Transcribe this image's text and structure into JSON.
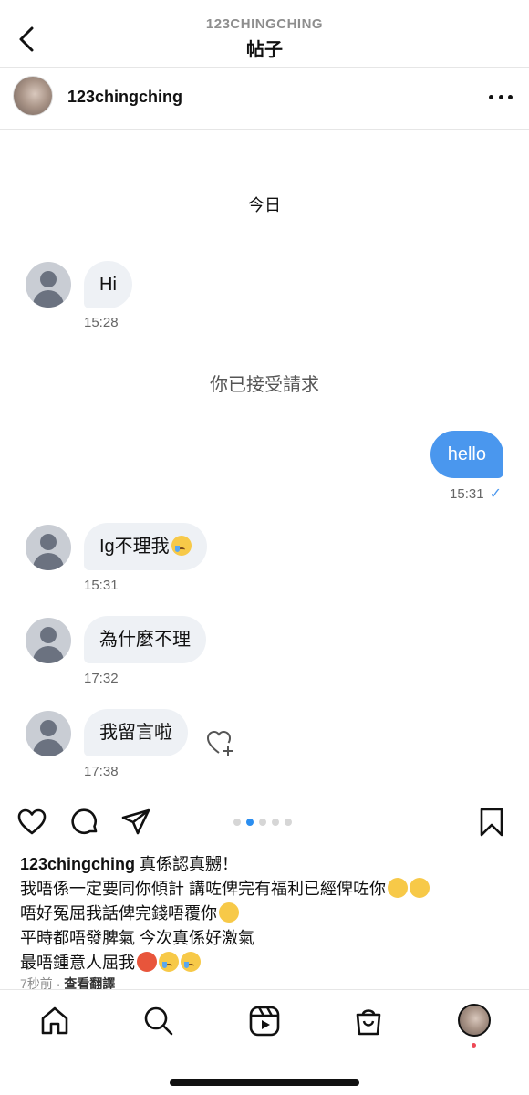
{
  "header": {
    "subtitle": "123CHINGCHING",
    "title": "帖子"
  },
  "post_owner": {
    "username": "123chingching"
  },
  "screenshot": {
    "date_label": "今日",
    "system_message": "你已接受請求",
    "messages": [
      {
        "from": "them",
        "text": "Hi",
        "time": "15:28"
      },
      {
        "from": "me",
        "text": "hello",
        "time": "15:31"
      },
      {
        "from": "them",
        "text": "Ig不理我",
        "time": "15:31",
        "emoji": "crying-face"
      },
      {
        "from": "them",
        "text": "為什麼不理",
        "time": "17:32"
      },
      {
        "from": "them",
        "text": "我留言啦",
        "time": "17:38"
      }
    ],
    "read_mark": "✓"
  },
  "carousel": {
    "count": 5,
    "active_index": 1
  },
  "caption": {
    "username": "123chingching",
    "line1_text": " 真係認真嬲！",
    "line2_text": "我唔係一定要同你傾計 講咗俾完有福利已經俾咗你",
    "line3_text": "唔好冤屈我話俾完錢唔覆你",
    "line4_text": "平時都唔發脾氣 今次真係好激氣",
    "line5_text": "最唔鍾意人屈我",
    "emojis": [
      "slightly-smiling-face",
      "slightly-smiling-face",
      "smiling-face",
      "angry-face",
      "crying-face",
      "crying-face"
    ]
  },
  "meta": {
    "time_ago": "7秒前",
    "separator": "·",
    "translate_label": "查看翻譯"
  },
  "icons": {
    "back": "chevron-left-icon",
    "more": "more-horizontal-icon",
    "like": "heart-icon",
    "comment": "comment-icon",
    "share": "send-icon",
    "save": "bookmark-icon",
    "react": "heart-plus-icon",
    "nav": [
      "home-icon",
      "search-icon",
      "reels-icon",
      "shop-icon",
      "profile-avatar"
    ]
  },
  "colors": {
    "outgoing_bubble": "#4a97ee",
    "incoming_bubble": "#eef1f5",
    "carousel_active": "#2b8ef0",
    "notification_dot": "#ed4956"
  }
}
